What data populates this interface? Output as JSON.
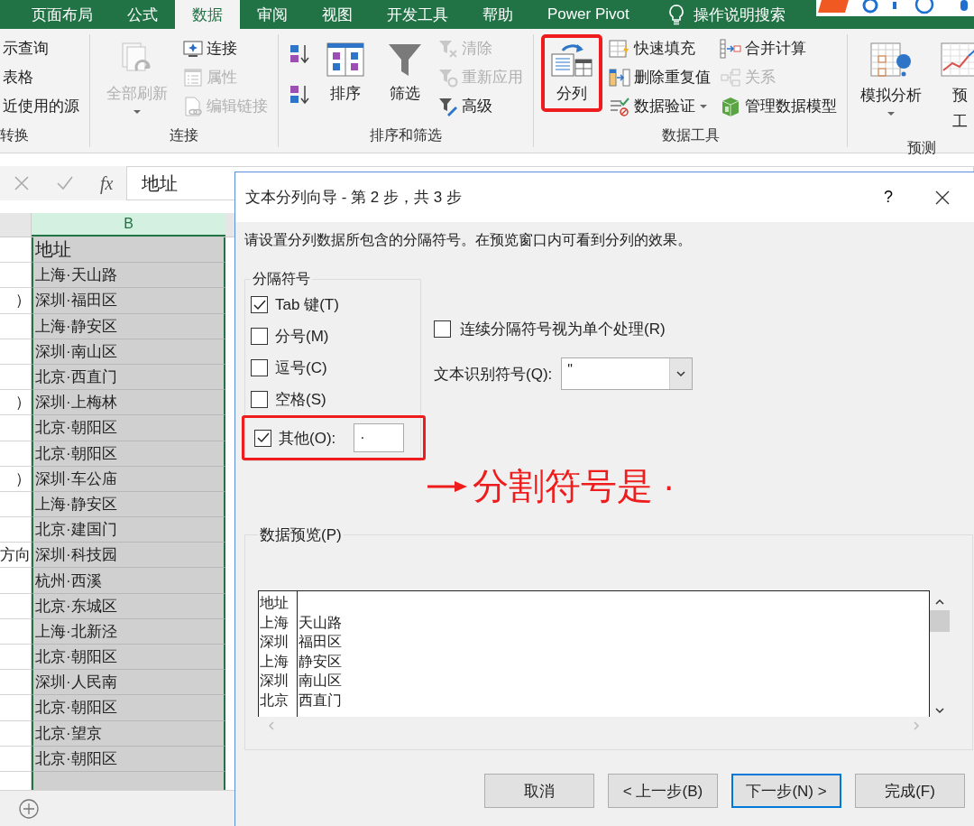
{
  "ribbon": {
    "tabs": [
      {
        "label": "页面布局",
        "selected": false
      },
      {
        "label": "公式",
        "selected": false
      },
      {
        "label": "数据",
        "selected": true
      },
      {
        "label": "审阅",
        "selected": false
      },
      {
        "label": "视图",
        "selected": false
      },
      {
        "label": "开发工具",
        "selected": false
      },
      {
        "label": "帮助",
        "selected": false
      },
      {
        "label": "Power Pivot",
        "selected": false
      }
    ],
    "tell_me": "操作说明搜索",
    "groups": [
      {
        "label": "转换",
        "columns": [
          [
            {
              "kind": "small",
              "label": "示查询",
              "disabled": false
            },
            {
              "kind": "small",
              "label": "表格",
              "disabled": false
            },
            {
              "kind": "small",
              "label": "近使用的源",
              "disabled": false
            }
          ]
        ]
      },
      {
        "label": "连接",
        "columns": [
          [
            {
              "kind": "large",
              "label": "全部刷新",
              "disabled": true,
              "dropdown": true
            }
          ],
          [
            {
              "kind": "small",
              "label": "连接",
              "disabled": false
            },
            {
              "kind": "small",
              "label": "属性",
              "disabled": true
            },
            {
              "kind": "small",
              "label": "编辑链接",
              "disabled": true
            }
          ]
        ]
      },
      {
        "label": "排序和筛选",
        "columns": [
          [
            {
              "kind": "icon"
            },
            {
              "kind": "icon"
            }
          ],
          [
            {
              "kind": "large",
              "label": "排序",
              "disabled": false
            }
          ],
          [
            {
              "kind": "large",
              "label": "筛选",
              "disabled": false
            }
          ],
          [
            {
              "kind": "small",
              "label": "清除",
              "disabled": true
            },
            {
              "kind": "small",
              "label": "重新应用",
              "disabled": true
            },
            {
              "kind": "small",
              "label": "高级",
              "disabled": false
            }
          ]
        ]
      },
      {
        "label": "数据工具",
        "columns": [
          [
            {
              "kind": "large",
              "label": "分列",
              "disabled": false,
              "highlighted": true
            }
          ],
          [
            {
              "kind": "small",
              "label": "快速填充",
              "disabled": false
            },
            {
              "kind": "small",
              "label": "删除重复值",
              "disabled": false
            },
            {
              "kind": "small",
              "label": "数据验证",
              "disabled": false,
              "dropdown": true
            }
          ],
          [
            {
              "kind": "small",
              "label": "合并计算",
              "disabled": false
            },
            {
              "kind": "small",
              "label": "关系",
              "disabled": true
            },
            {
              "kind": "small",
              "label": "管理数据模型",
              "disabled": false
            }
          ]
        ]
      },
      {
        "label": "预测",
        "columns": [
          [
            {
              "kind": "large",
              "label": "模拟分析",
              "disabled": false,
              "dropdown": true
            }
          ],
          [
            {
              "kind": "large",
              "label": "预",
              "label_2": "工",
              "disabled": false
            }
          ]
        ]
      }
    ]
  },
  "formula_bar": {
    "function_label": "fx",
    "value": "地址"
  },
  "sheet": {
    "column_header": "B",
    "header": "地址",
    "rows": [
      {
        "column_b": "上海·天山路"
      },
      {
        "column_a": "）",
        "column_b": "深圳·福田区"
      },
      {
        "column_b": "上海·静安区"
      },
      {
        "column_b": "深圳·南山区"
      },
      {
        "column_b": "北京·西直门"
      },
      {
        "column_a": "）",
        "column_b": "深圳·上梅林"
      },
      {
        "column_b": "北京·朝阳区"
      },
      {
        "column_b": "北京·朝阳区"
      },
      {
        "column_a": "）",
        "column_b": "深圳·车公庙"
      },
      {
        "column_b": "上海·静安区"
      },
      {
        "column_b": "北京·建国门"
      },
      {
        "column_a": "方向",
        "column_b": "深圳·科技园"
      },
      {
        "column_b": "杭州·西溪"
      },
      {
        "column_b": "北京·东城区"
      },
      {
        "column_b": "上海·北新泾"
      },
      {
        "column_b": "北京·朝阳区"
      },
      {
        "column_b": "深圳·人民南"
      },
      {
        "column_b": "北京·朝阳区"
      },
      {
        "column_b": "北京·望京"
      },
      {
        "column_b": "北京·朝阳区"
      }
    ]
  },
  "dialog": {
    "title": "文本分列向导 - 第 2 步，共 3 步",
    "help": "?",
    "instruction": "请设置分列数据所包含的分隔符号。在预览窗口内可看到分列的效果。",
    "delimiters": {
      "legend": "分隔符号",
      "options": [
        {
          "label": "Tab 键(T)",
          "checked": true
        },
        {
          "label": "分号(M)",
          "checked": false
        },
        {
          "label": "逗号(C)",
          "checked": false
        },
        {
          "label": "空格(S)",
          "checked": false
        },
        {
          "label": "其他(O):",
          "checked": true,
          "highlighted": true,
          "value": "·"
        }
      ]
    },
    "treat_consecutive": {
      "label": "连续分隔符号视为单个处理(R)",
      "checked": false
    },
    "text_qualifier": {
      "label": "文本识别符号(Q):",
      "value": "\""
    },
    "preview": {
      "legend": "数据预览(P)",
      "rows": [
        [
          "地址"
        ],
        [
          "上海",
          "天山路"
        ],
        [
          "深圳",
          "福田区"
        ],
        [
          "上海",
          "静安区"
        ],
        [
          "深圳",
          "南山区"
        ],
        [
          "北京",
          "西直门"
        ]
      ]
    },
    "buttons": [
      {
        "label": "取消",
        "focused": false
      },
      {
        "label": "< 上一步(B)",
        "focused": false
      },
      {
        "label": "下一步(N) >",
        "focused": true
      },
      {
        "label": "完成(F)",
        "focused": false
      }
    ]
  },
  "annotation": {
    "text": "分割符号是 ·"
  }
}
